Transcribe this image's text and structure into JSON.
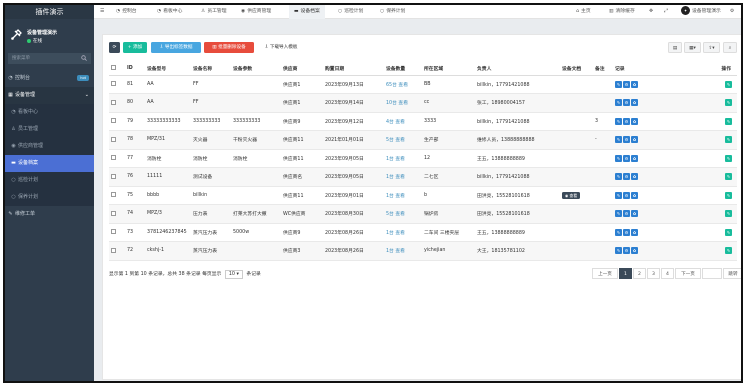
{
  "app": {
    "brand": "插件演示",
    "user_name": "设备管理演示",
    "user_status": "在线"
  },
  "sidebar": {
    "search_placeholder": "搜索菜单",
    "items": [
      {
        "label": "控制台",
        "icon": "dashboard-icon",
        "badge": "hot"
      },
      {
        "label": "设备管理",
        "icon": "grid-icon"
      },
      {
        "label": "看板中心",
        "icon": "dashboard-icon"
      },
      {
        "label": "员工管理",
        "icon": "user-icon"
      },
      {
        "label": "供应商管理",
        "icon": "eye-icon"
      },
      {
        "label": "设备档案",
        "icon": "folder-icon"
      },
      {
        "label": "巡检计划",
        "icon": "circle-icon"
      },
      {
        "label": "保养计划",
        "icon": "circle-icon"
      },
      {
        "label": "维修工单",
        "icon": "wrench-icon"
      }
    ]
  },
  "topbar": {
    "tabs": [
      "控制台",
      "看板中心",
      "员工管理",
      "供应商管理",
      "设备档案",
      "巡检计划",
      "保养计划"
    ],
    "right": {
      "home": "主页",
      "clear_cache": "清除缓存",
      "user": "设备管理演示"
    }
  },
  "toolbar": {
    "add": "添加",
    "export_tag": "导出标签数据",
    "batch_delete": "批量删除设备",
    "download_template": "下载导入模板"
  },
  "table": {
    "headers": [
      "",
      "ID",
      "设备型号",
      "设备名称",
      "设备参数",
      "供应商",
      "购置日期",
      "设备数量",
      "所在区域",
      "负责人",
      "设备文档",
      "备注",
      "记录",
      "操作"
    ],
    "rows": [
      {
        "id": "81",
        "model": "AA",
        "name": "FF",
        "params": "",
        "supplier": "供应商1",
        "date": "2023年09月13日",
        "qty": "65台 查看",
        "area": "BB",
        "owner": "billkin，17791421088",
        "doc": "",
        "note": ""
      },
      {
        "id": "80",
        "model": "AA",
        "name": "FF",
        "params": "",
        "supplier": "供应商1",
        "date": "2023年09月14日",
        "qty": "10台 查看",
        "area": "cc",
        "owner": "张工，18980004157",
        "doc": "",
        "note": ""
      },
      {
        "id": "79",
        "model": "33333333333",
        "name": "333333333",
        "params": "333333333",
        "supplier": "供应商9",
        "date": "2023年09月12日",
        "qty": "4台 查看",
        "area": "3333",
        "owner": "billkin，17791421088",
        "doc": "",
        "note": "3"
      },
      {
        "id": "78",
        "model": "MPZ/31",
        "name": "灭火器",
        "params": "干粉灭火器",
        "supplier": "供应商11",
        "date": "2021年01月01日",
        "qty": "5台 查看",
        "area": "生产部",
        "owner": "维修人员，13888888888",
        "doc": "",
        "note": "-"
      },
      {
        "id": "77",
        "model": "消防栓",
        "name": "消防栓",
        "params": "消防栓",
        "supplier": "供应商11",
        "date": "2023年09月05日",
        "qty": "1台 查看",
        "area": "12",
        "owner": "王五，13888888889",
        "doc": "",
        "note": ""
      },
      {
        "id": "76",
        "model": "11111",
        "name": "测试设备",
        "params": "",
        "supplier": "供应商名",
        "date": "2023年09月05日",
        "qty": "1台 查看",
        "area": "二七区",
        "owner": "billkin，17791421088",
        "doc": "",
        "note": ""
      },
      {
        "id": "75",
        "model": "bbbb",
        "name": "billkin",
        "params": "",
        "supplier": "供应商11",
        "date": "2023年09月01日",
        "qty": "1台 查看",
        "area": "b",
        "owner": "田洪亮，15528101618",
        "doc": "查看",
        "note": ""
      },
      {
        "id": "74",
        "model": "MPZ/3",
        "name": "压力表",
        "params": "打莱大苏打大撒",
        "supplier": "WC供应商",
        "date": "2023年08月30日",
        "qty": "5台 查看",
        "area": "锅炉房",
        "owner": "田洪亮，15528101618",
        "doc": "",
        "note": ""
      },
      {
        "id": "73",
        "model": "3781246237845",
        "name": "蒸汽压力表",
        "params": "5000w",
        "supplier": "供应商9",
        "date": "2023年08月26日",
        "qty": "1台 查看",
        "area": "二车间 三楼夹层",
        "owner": "王五，13888888889",
        "doc": "",
        "note": ""
      },
      {
        "id": "72",
        "model": "ckshj-1",
        "name": "蒸汽压力表",
        "params": "",
        "supplier": "供应商3",
        "date": "2023年08月26日",
        "qty": "1台 查看",
        "area": "yichejian",
        "owner": "大王，18135781102",
        "doc": "",
        "note": ""
      }
    ]
  },
  "footer": {
    "summary": "显示第 1 到第 10 条记录，总共 38 条记录 每页显示",
    "page_size": "10",
    "suffix": "条记录"
  },
  "pagination": {
    "prev": "上一页",
    "pages": [
      "1",
      "2",
      "3",
      "4"
    ],
    "next": "下一页",
    "jump": "跳转"
  }
}
